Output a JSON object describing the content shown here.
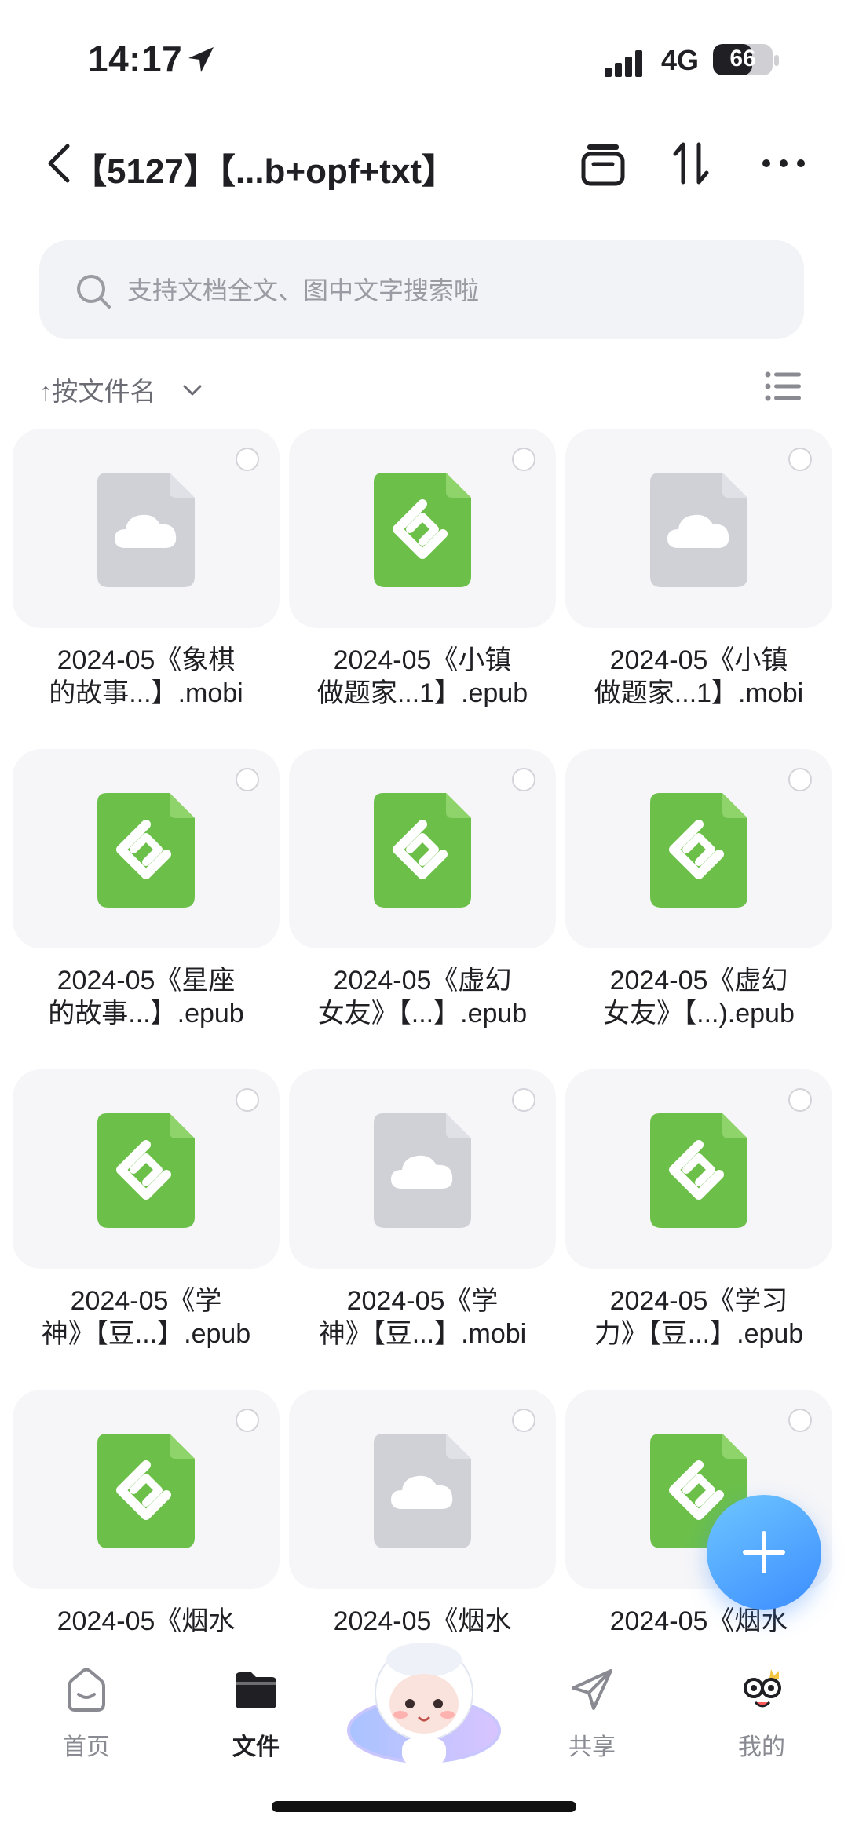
{
  "status_bar": {
    "time": "14:17",
    "network": "4G",
    "battery": "66",
    "battery_level": 0.66
  },
  "header": {
    "title": "【5127】【...b+opf+txt】"
  },
  "search": {
    "placeholder": "支持文档全文、图中文字搜索啦"
  },
  "sort": {
    "label": "↑按文件名"
  },
  "files": [
    {
      "name_line1": "2024-05《象棋",
      "name_line2": "的故事...】.mobi",
      "type": "mobi",
      "icon": "cloud-file-icon"
    },
    {
      "name_line1": "2024-05《小镇",
      "name_line2": "做题家...1】.epub",
      "type": "epub",
      "icon": "epub-file-icon"
    },
    {
      "name_line1": "2024-05《小镇",
      "name_line2": "做题家...1】.mobi",
      "type": "mobi",
      "icon": "cloud-file-icon"
    },
    {
      "name_line1": "2024-05《星座",
      "name_line2": "的故事...】.epub",
      "type": "epub",
      "icon": "epub-file-icon"
    },
    {
      "name_line1": "2024-05《虚幻",
      "name_line2": "女友》【...】.epub",
      "type": "epub",
      "icon": "epub-file-icon"
    },
    {
      "name_line1": "2024-05《虚幻",
      "name_line2": "女友》【...).epub",
      "type": "epub",
      "icon": "epub-file-icon"
    },
    {
      "name_line1": "2024-05《学",
      "name_line2": "神》【豆...】.epub",
      "type": "epub",
      "icon": "epub-file-icon"
    },
    {
      "name_line1": "2024-05《学",
      "name_line2": "神》【豆...】.mobi",
      "type": "mobi",
      "icon": "cloud-file-icon"
    },
    {
      "name_line1": "2024-05《学习",
      "name_line2": "力》【豆...】.epub",
      "type": "epub",
      "icon": "epub-file-icon"
    },
    {
      "name_line1": "2024-05《烟水",
      "name_line2": "",
      "type": "epub",
      "icon": "epub-file-icon"
    },
    {
      "name_line1": "2024-05《烟水",
      "name_line2": "",
      "type": "mobi",
      "icon": "cloud-file-icon"
    },
    {
      "name_line1": "2024-05《烟水",
      "name_line2": "",
      "type": "epub",
      "icon": "epub-file-icon"
    }
  ],
  "tabs": {
    "home": "首页",
    "files": "文件",
    "share": "共享",
    "mine": "我的"
  },
  "colors": {
    "accent": "#3c8dff",
    "epub_green": "#6cc04a",
    "cloud_gray": "#cfd1d7"
  }
}
